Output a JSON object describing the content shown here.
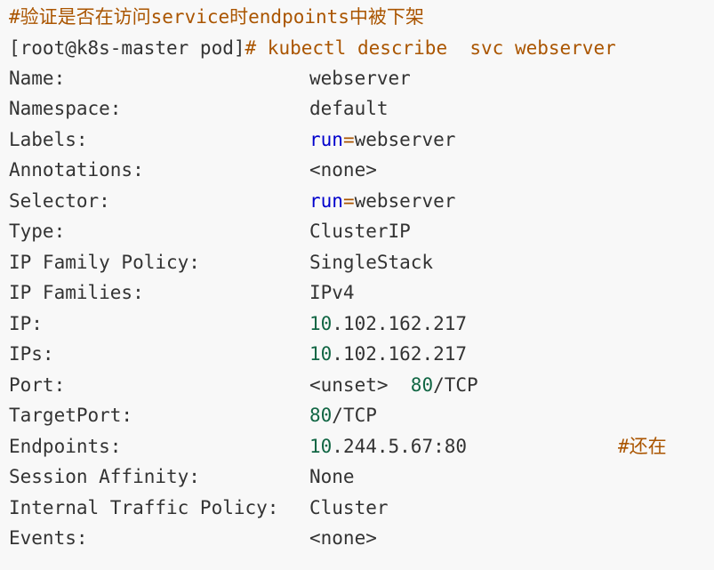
{
  "comment_line": "#验证是否在访问service时endpoints中被下架",
  "prompt": "[root@k8s-master pod]",
  "command": "# kubectl describe  svc webserver",
  "fields": {
    "name": {
      "key": "Name:",
      "value": "webserver"
    },
    "namespace": {
      "key": "Namespace:",
      "value": "default"
    },
    "labels": {
      "key": "Labels:",
      "k": "run",
      "eq": "=",
      "v": "webserver"
    },
    "annotations": {
      "key": "Annotations:",
      "value": "<none>"
    },
    "selector": {
      "key": "Selector:",
      "k": "run",
      "eq": "=",
      "v": "webserver"
    },
    "type": {
      "key": "Type:",
      "value": "ClusterIP"
    },
    "ip_family_policy": {
      "key": "IP Family Policy:",
      "value": "SingleStack"
    },
    "ip_families": {
      "key": "IP Families:",
      "value": "IPv4"
    },
    "ip": {
      "key": "IP:",
      "num": "10",
      "rest": ".102.162.217"
    },
    "ips": {
      "key": "IPs:",
      "num": "10",
      "rest": ".102.162.217"
    },
    "port": {
      "key": "Port:",
      "pre": "<unset>  ",
      "num": "80",
      "rest": "/TCP"
    },
    "target_port": {
      "key": "TargetPort:",
      "num": "80",
      "rest": "/TCP"
    },
    "endpoints": {
      "key": "Endpoints:",
      "num": "10",
      "rest": ".244.5.67:80",
      "comment": "#还在"
    },
    "session_affinity": {
      "key": "Session Affinity:",
      "value": "None"
    },
    "internal_traffic_policy": {
      "key": "Internal Traffic Policy:",
      "value": "Cluster"
    },
    "events": {
      "key": "Events:",
      "value": "<none>"
    }
  },
  "colors": {
    "background": "#f8f8f8",
    "text": "#333333",
    "comment": "#aa5500",
    "keyword": "#0000cc",
    "number": "#116644"
  }
}
